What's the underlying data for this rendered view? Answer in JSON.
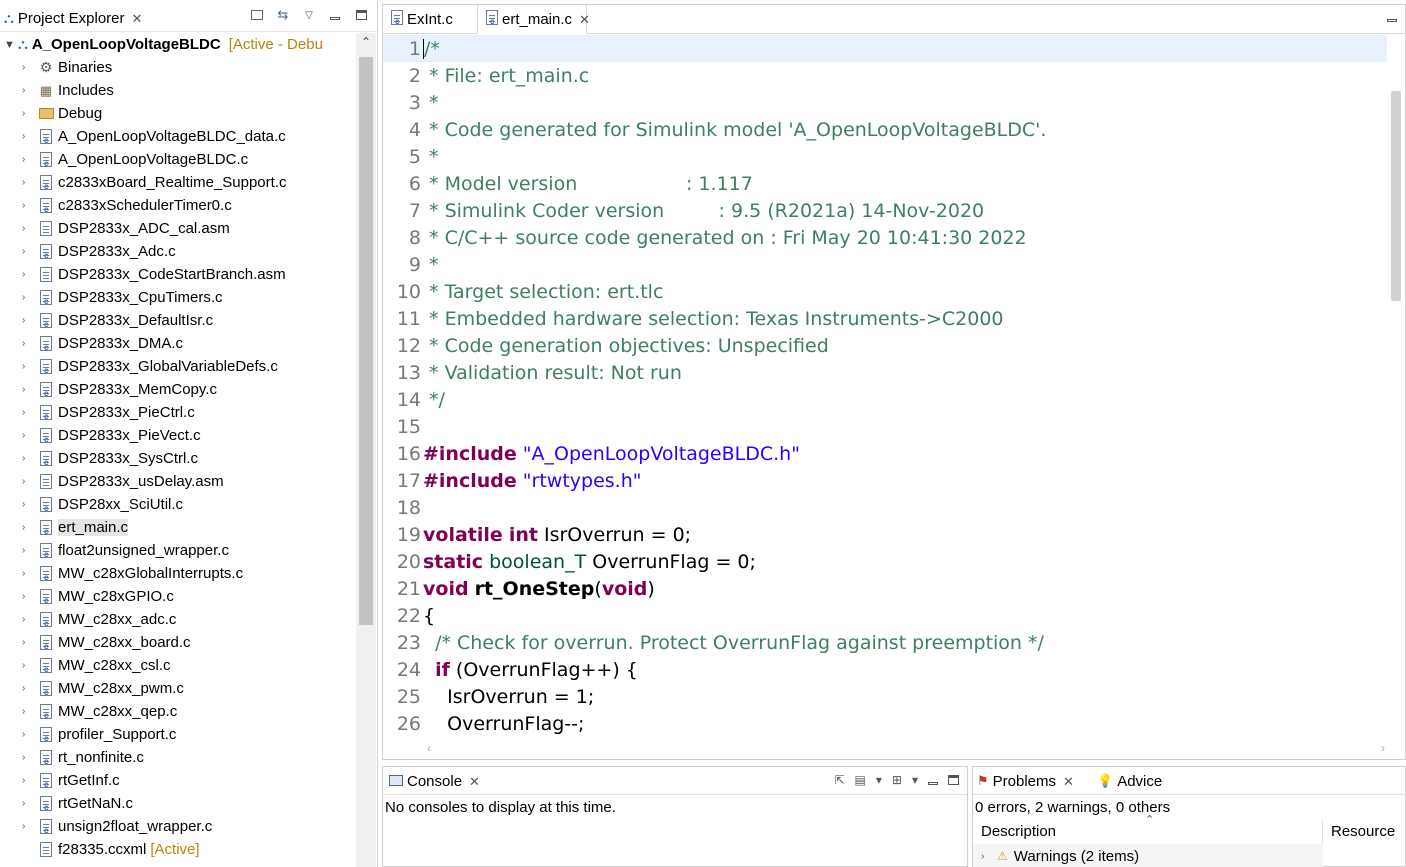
{
  "explorer": {
    "title": "Project Explorer",
    "project": {
      "name": "A_OpenLoopVoltageBLDC",
      "state": "[Active - Debu"
    },
    "items": [
      {
        "label": "Binaries",
        "icon": "binaries-icon"
      },
      {
        "label": "Includes",
        "icon": "includes-icon"
      },
      {
        "label": "Debug",
        "icon": "folder-icon"
      },
      {
        "label": "A_OpenLoopVoltageBLDC_data.c",
        "icon": "c-file-icon"
      },
      {
        "label": "A_OpenLoopVoltageBLDC.c",
        "icon": "c-file-icon"
      },
      {
        "label": "c2833xBoard_Realtime_Support.c",
        "icon": "c-file-icon"
      },
      {
        "label": "c2833xSchedulerTimer0.c",
        "icon": "c-file-icon"
      },
      {
        "label": "DSP2833x_ADC_cal.asm",
        "icon": "asm-file-icon"
      },
      {
        "label": "DSP2833x_Adc.c",
        "icon": "c-file-icon"
      },
      {
        "label": "DSP2833x_CodeStartBranch.asm",
        "icon": "asm-file-icon"
      },
      {
        "label": "DSP2833x_CpuTimers.c",
        "icon": "c-file-icon"
      },
      {
        "label": "DSP2833x_DefaultIsr.c",
        "icon": "c-file-icon"
      },
      {
        "label": "DSP2833x_DMA.c",
        "icon": "c-file-icon"
      },
      {
        "label": "DSP2833x_GlobalVariableDefs.c",
        "icon": "c-file-icon"
      },
      {
        "label": "DSP2833x_MemCopy.c",
        "icon": "c-file-icon"
      },
      {
        "label": "DSP2833x_PieCtrl.c",
        "icon": "c-file-icon"
      },
      {
        "label": "DSP2833x_PieVect.c",
        "icon": "c-file-icon"
      },
      {
        "label": "DSP2833x_SysCtrl.c",
        "icon": "c-file-icon"
      },
      {
        "label": "DSP2833x_usDelay.asm",
        "icon": "asm-file-icon"
      },
      {
        "label": "DSP28xx_SciUtil.c",
        "icon": "c-file-icon"
      },
      {
        "label": "ert_main.c",
        "icon": "c-file-icon",
        "selected": true
      },
      {
        "label": "float2unsigned_wrapper.c",
        "icon": "c-file-icon"
      },
      {
        "label": "MW_c28xGlobalInterrupts.c",
        "icon": "c-file-icon"
      },
      {
        "label": "MW_c28xGPIO.c",
        "icon": "c-file-icon"
      },
      {
        "label": "MW_c28xx_adc.c",
        "icon": "c-file-icon"
      },
      {
        "label": "MW_c28xx_board.c",
        "icon": "c-file-icon"
      },
      {
        "label": "MW_c28xx_csl.c",
        "icon": "c-file-icon"
      },
      {
        "label": "MW_c28xx_pwm.c",
        "icon": "c-file-icon"
      },
      {
        "label": "MW_c28xx_qep.c",
        "icon": "c-file-icon"
      },
      {
        "label": "profiler_Support.c",
        "icon": "c-file-icon"
      },
      {
        "label": "rt_nonfinite.c",
        "icon": "c-file-icon"
      },
      {
        "label": "rtGetInf.c",
        "icon": "c-file-icon"
      },
      {
        "label": "rtGetNaN.c",
        "icon": "c-file-icon"
      },
      {
        "label": "unsign2float_wrapper.c",
        "icon": "c-file-icon"
      },
      {
        "label": "f28335.ccxml",
        "icon": "ccxml-file-icon",
        "tag": "[Active]",
        "noArrow": true
      }
    ]
  },
  "editor": {
    "tabs": [
      {
        "label": "ExInt.c",
        "active": false
      },
      {
        "label": "ert_main.c",
        "active": true
      }
    ],
    "lines": [
      [
        [
          "c",
          "/*"
        ]
      ],
      [
        [
          "c",
          " * File: ert_main.c"
        ]
      ],
      [
        [
          "c",
          " *"
        ]
      ],
      [
        [
          "c",
          " * Code generated for Simulink model 'A_OpenLoopVoltageBLDC'."
        ]
      ],
      [
        [
          "c",
          " *"
        ]
      ],
      [
        [
          "c",
          " * Model version                  : 1.117"
        ]
      ],
      [
        [
          "c",
          " * Simulink Coder version         : 9.5 (R2021a) 14-Nov-2020"
        ]
      ],
      [
        [
          "c",
          " * C/C++ source code generated on : Fri May 20 10:41:30 2022"
        ]
      ],
      [
        [
          "c",
          " *"
        ]
      ],
      [
        [
          "c",
          " * Target selection: ert.tlc"
        ]
      ],
      [
        [
          "c",
          " * Embedded hardware selection: Texas Instruments->C2000"
        ]
      ],
      [
        [
          "c",
          " * Code generation objectives: Unspecified"
        ]
      ],
      [
        [
          "c",
          " * Validation result: Not run"
        ]
      ],
      [
        [
          "c",
          " */"
        ]
      ],
      [],
      [
        [
          "k",
          "#include"
        ],
        [
          "p",
          " "
        ],
        [
          "s",
          "\"A_OpenLoopVoltageBLDC.h\""
        ]
      ],
      [
        [
          "k",
          "#include"
        ],
        [
          "p",
          " "
        ],
        [
          "s",
          "\"rtwtypes.h\""
        ]
      ],
      [],
      [
        [
          "k",
          "volatile"
        ],
        [
          "p",
          " "
        ],
        [
          "k",
          "int"
        ],
        [
          "p",
          " IsrOverrun = 0;"
        ]
      ],
      [
        [
          "k",
          "static"
        ],
        [
          "p",
          " "
        ],
        [
          "t",
          "boolean_T"
        ],
        [
          "p",
          " OverrunFlag = 0;"
        ]
      ],
      [
        [
          "k",
          "void"
        ],
        [
          "p",
          " "
        ],
        [
          "f",
          "rt_OneStep"
        ],
        [
          "p",
          "("
        ],
        [
          "k",
          "void"
        ],
        [
          "p",
          ")"
        ]
      ],
      [
        [
          "p",
          "{"
        ]
      ],
      [
        [
          "p",
          "  "
        ],
        [
          "c",
          "/* Check for overrun. Protect OverrunFlag against preemption */"
        ]
      ],
      [
        [
          "p",
          "  "
        ],
        [
          "k",
          "if"
        ],
        [
          "p",
          " (OverrunFlag++) {"
        ]
      ],
      [
        [
          "p",
          "    IsrOverrun = 1;"
        ]
      ],
      [
        [
          "p",
          "    OverrunFlag--;"
        ]
      ]
    ]
  },
  "console": {
    "title": "Console",
    "message": "No consoles to display at this time."
  },
  "problems": {
    "tabs": [
      "Problems",
      "Advice"
    ],
    "summary": "0 errors, 2 warnings, 0 others",
    "columns": [
      "Description",
      "Resource"
    ],
    "rows": [
      {
        "label": "Warnings (2 items)"
      }
    ]
  }
}
